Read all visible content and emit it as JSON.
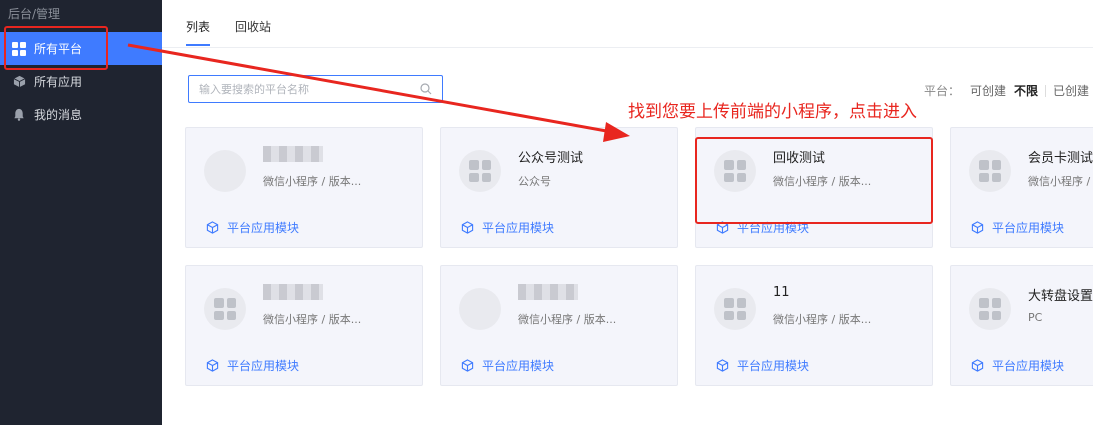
{
  "sidebar": {
    "breadcrumb": "后台/管理",
    "items": [
      {
        "label": "所有平台",
        "icon": "grid-icon",
        "active": true
      },
      {
        "label": "所有应用",
        "icon": "cube-icon",
        "active": false
      },
      {
        "label": "我的消息",
        "icon": "bell-icon",
        "active": false
      }
    ]
  },
  "tabs": [
    {
      "label": "列表",
      "active": true
    },
    {
      "label": "回收站",
      "active": false
    }
  ],
  "search": {
    "placeholder": "输入要搜索的平台名称",
    "value": ""
  },
  "filter": {
    "label": "平台：",
    "options": [
      "可创建",
      "不限",
      "已创建"
    ],
    "selected": "不限"
  },
  "annotation": "找到您要上传前端的小程序，点击进入",
  "cards": [
    {
      "title": "",
      "subtitle": "微信小程序 / 版本...",
      "module": "平台应用模块",
      "title_blurred": true
    },
    {
      "title": "公众号测试",
      "subtitle": "公众号",
      "module": "平台应用模块"
    },
    {
      "title": "回收测试",
      "subtitle": "微信小程序 / 版本...",
      "module": "平台应用模块"
    },
    {
      "title": "会员卡测试",
      "subtitle": "微信小程序 / 版本",
      "module": "平台应用模块"
    },
    {
      "title": "",
      "subtitle": "微信小程序 / 版本...",
      "module": "平台应用模块",
      "title_blurred": true
    },
    {
      "title": "",
      "subtitle": "微信小程序 / 版本...",
      "module": "平台应用模块",
      "title_blurred": true
    },
    {
      "title": "11",
      "subtitle": "微信小程序 / 版本...",
      "module": "平台应用模块"
    },
    {
      "title": "大转盘设置",
      "subtitle": "PC",
      "module": "平台应用模块"
    }
  ],
  "colors": {
    "accent": "#3f7bff",
    "sidebar_bg": "#1f2430",
    "annotation": "#e8261f"
  }
}
